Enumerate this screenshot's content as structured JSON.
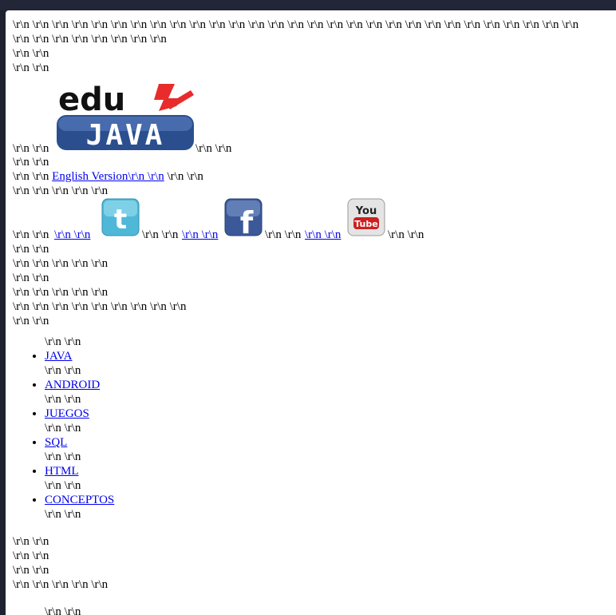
{
  "junk": {
    "row1": "\\r\\n \\r\\n \\r\\n \\r\\n \\r\\n \\r\\n \\r\\n \\r\\n \\r\\n \\r\\n \\r\\n \\r\\n \\r\\n \\r\\n \\r\\n \\r\\n \\r\\n \\r\\n \\r\\n \\r\\n \\r\\n \\r\\n \\r\\n \\r\\n \\r\\n \\r\\n \\r\\n \\r\\n \\r\\n",
    "row2": "\\r\\n \\r\\n \\r\\n \\r\\n \\r\\n \\r\\n \\r\\n \\r\\n",
    "pair": "\\r\\n \\r\\n",
    "five": "\\r\\n \\r\\n \\r\\n \\r\\n \\r\\n",
    "nine": "\\r\\n \\r\\n \\r\\n \\r\\n \\r\\n \\r\\n \\r\\n \\r\\n \\r\\n"
  },
  "logo": {
    "top": "edu",
    "bottom": "JAVA",
    "accent_color": "#e82c2c",
    "bar_color": "#2b4f8e"
  },
  "english_link": "English Version\\r\\n \\r\\n",
  "social": {
    "link_text": "\\r\\n \\r\\n",
    "twitter_color": "#4fb8d8",
    "facebook_color": "#3b5998",
    "youtube_you": "You",
    "youtube_tube": "Tube"
  },
  "menu": {
    "items": [
      {
        "label": "JAVA"
      },
      {
        "label": "ANDROID"
      },
      {
        "label": "JUEGOS"
      },
      {
        "label": "SQL"
      },
      {
        "label": "HTML"
      },
      {
        "label": "CONCEPTOS"
      }
    ]
  }
}
